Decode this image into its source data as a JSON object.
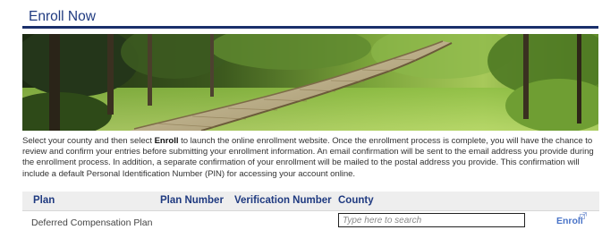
{
  "header": {
    "title": "Enroll Now"
  },
  "intro": {
    "part1": "Select your county and then select ",
    "bold": "Enroll",
    "part2": " to launch the online enrollment website. Once the enrollment process is complete, you will have the chance to review and confirm your entries before submitting your enrollment information. An email confirmation will be sent to the email address you provide during the enrollment process. In addition, a separate confirmation of your enrollment will be mailed to the postal address you provide. This confirmation will include a default Personal Identification Number (PIN) for accessing your account online."
  },
  "table": {
    "headers": {
      "plan": "Plan",
      "plan_number": "Plan Number",
      "verification_number": "Verification Number",
      "county": "County"
    },
    "rows": [
      {
        "plan": "Deferred Compensation Plan",
        "plan_number": "",
        "verification_number": "",
        "county_placeholder": "Type here to search",
        "action": "Enroll"
      }
    ]
  },
  "icons": {
    "external_link": "external-link-icon"
  },
  "colors": {
    "header_text": "#1f3a80",
    "header_rule": "#1a2f6b",
    "link": "#4a74c8",
    "table_header_bg": "#eeeeee"
  }
}
